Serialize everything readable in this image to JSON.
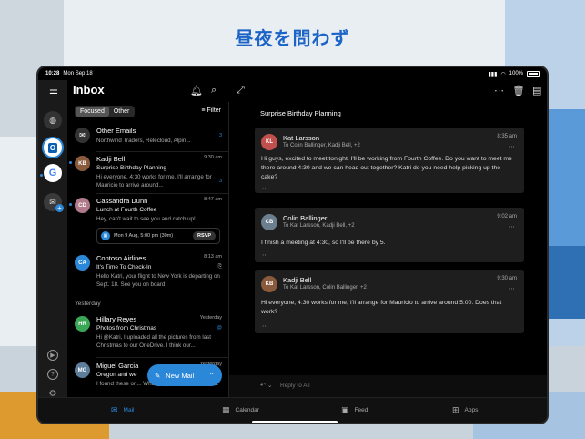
{
  "headline": "昼夜を問わず",
  "status": {
    "time": "10:28",
    "date": "Mon Sep 18",
    "battery": "100%"
  },
  "header": {
    "title": "Inbox"
  },
  "tabs": {
    "focused": "Focused",
    "other": "Other",
    "filter": "Filter"
  },
  "mails": [
    {
      "sender": "Other Emails",
      "preview": "Northwind Traders, Relecloud, Alpin...",
      "count": "3"
    },
    {
      "sender": "Kadji Bell",
      "time": "9:30 am",
      "subject": "Surprise Birthday Planning",
      "preview": "Hi everyone, 4:30 works for me, I'll arrange for Mauricio to arrive around...",
      "count": "3"
    },
    {
      "sender": "Cassandra Dunn",
      "time": "8:47 am",
      "subject": "Lunch at Fourth Coffee",
      "preview": "Hey, can't wait to see you and catch up!"
    },
    {
      "sender": "Contoso Airlines",
      "initials": "CA",
      "time": "8:13 am",
      "subject": "It's Time To Check-In",
      "preview": "Hello Katri, your flight to New York is departing on Sept. 18. See you on board!"
    },
    {
      "sender": "Hillary Reyes",
      "initials": "HR",
      "time": "Yesterday",
      "subject": "Photos from Christmas",
      "preview": "Hi @Katri, I uploaded all the pictures from last Christmas to our OneDrive. I think our..."
    },
    {
      "sender": "Miguel Garcia",
      "time": "Yesterday",
      "subject": "Oregon and we",
      "preview": "I found these on... What do you think? I like the..."
    }
  ],
  "event": {
    "when": "Mon 9 Aug, 5:00 pm (30m)",
    "rsvp": "RSVP"
  },
  "section_yesterday": "Yesterday",
  "new_mail": "New Mail",
  "thread": {
    "title": "Surprise Birthday Planning",
    "messages": [
      {
        "from": "Kat Larsson",
        "to": "To Colin Ballinger, Kadji Bell, +2",
        "time": "8:35 am",
        "body": "Hi guys, excited to meet tonight. I'll be working from Fourth Coffee. Do you want to meet me there around 4:30 and we can head out together? Katri do you need help picking up the cake?"
      },
      {
        "from": "Colin Ballinger",
        "to": "To Kat Larsson, Kadji Bell, +2",
        "time": "9:02 am",
        "body": "I finish a meeting at 4:30, so I'll be there by 5."
      },
      {
        "from": "Kadji Bell",
        "to": "To Kat Larsson, Colin Ballinger, +2",
        "time": "9:30 am",
        "body": "Hi everyone, 4:30 works for me, I'll arrange for Mauricio to arrive around 5:00. Does that work?"
      }
    ]
  },
  "reply": {
    "placeholder": "Reply to All"
  },
  "tabbar": {
    "mail": "Mail",
    "calendar": "Calendar",
    "feed": "Feed",
    "apps": "Apps"
  },
  "colors": {
    "accent": "#2b88d8"
  }
}
